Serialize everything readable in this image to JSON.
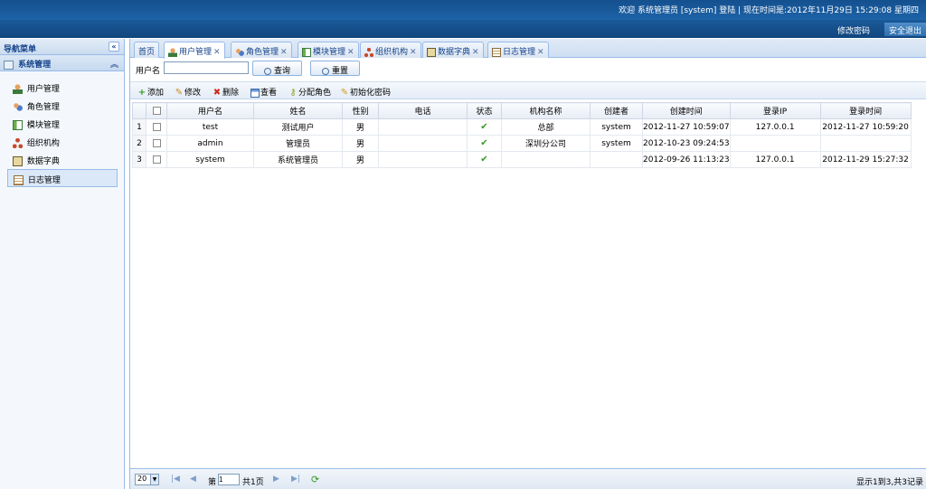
{
  "header": {
    "welcome": "欢迎 系统管理员 [system] 登陆 | 现在时间是:2012年11月29日 15:29:08 星期四",
    "change_password": "修改密码",
    "logout": "安全退出"
  },
  "nav": {
    "title": "导航菜单",
    "section": "系统管理",
    "items": [
      {
        "label": "用户管理",
        "icon": "user-icon"
      },
      {
        "label": "角色管理",
        "icon": "role-icon"
      },
      {
        "label": "模块管理",
        "icon": "module-icon"
      },
      {
        "label": "组织机构",
        "icon": "org-icon"
      },
      {
        "label": "数据字典",
        "icon": "dictionary-icon"
      },
      {
        "label": "日志管理",
        "icon": "log-icon"
      }
    ]
  },
  "tabs": [
    {
      "label": "首页"
    },
    {
      "label": "用户管理"
    },
    {
      "label": "角色管理"
    },
    {
      "label": "模块管理"
    },
    {
      "label": "组织机构"
    },
    {
      "label": "数据字典"
    },
    {
      "label": "日志管理"
    }
  ],
  "search": {
    "label": "用户名",
    "value": "",
    "query": "查询",
    "reset": "重置"
  },
  "toolbar": {
    "add": "添加",
    "edit": "修改",
    "delete": "删除",
    "view": "查看",
    "assign_role": "分配角色",
    "init_password": "初始化密码"
  },
  "grid": {
    "columns": [
      "用户名",
      "姓名",
      "性别",
      "电话",
      "状态",
      "机构名称",
      "创建者",
      "创建时间",
      "登录IP",
      "登录时间"
    ],
    "rows": [
      {
        "num": "1",
        "username": "test",
        "name": "测试用户",
        "gender": "男",
        "phone": "",
        "org": "总部",
        "creator": "system",
        "created": "2012-11-27 10:59:07",
        "ip": "127.0.0.1",
        "login": "2012-11-27 10:59:20"
      },
      {
        "num": "2",
        "username": "admin",
        "name": "管理员",
        "gender": "男",
        "phone": "",
        "org": "深圳分公司",
        "creator": "system",
        "created": "2012-10-23 09:24:53",
        "ip": "",
        "login": ""
      },
      {
        "num": "3",
        "username": "system",
        "name": "系统管理员",
        "gender": "男",
        "phone": "",
        "org": "",
        "creator": "",
        "created": "2012-09-26 11:13:23",
        "ip": "127.0.0.1",
        "login": "2012-11-29 15:27:32"
      }
    ]
  },
  "pager": {
    "page_size": "20",
    "page_prefix": "第",
    "page_value": "1",
    "page_suffix": "共1页",
    "info": "显示1到3,共3记录"
  }
}
